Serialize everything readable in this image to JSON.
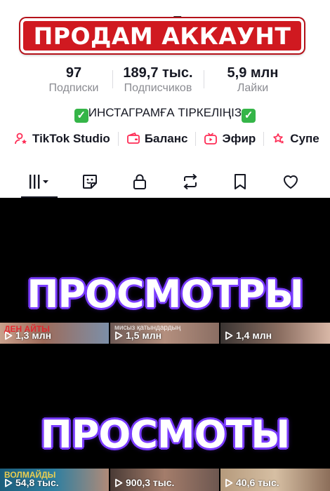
{
  "banner": {
    "sale_text": "ПРОДАМ  АККАУНТ"
  },
  "profile_name_fragment": "E",
  "stats": [
    {
      "value": "97",
      "label": "Подписки"
    },
    {
      "value": "189,7 тыс.",
      "label": "Подписчиков"
    },
    {
      "value": "5,9 млн",
      "label": "Лайки"
    }
  ],
  "bio": {
    "text": "ИНСТАГРАМҒА ТІРКЕЛІҢІЗ"
  },
  "actions": [
    {
      "label": "TikTok Studio",
      "icon": "person-star-icon"
    },
    {
      "label": "Баланс",
      "icon": "wallet-icon"
    },
    {
      "label": "Эфир",
      "icon": "live-tv-icon"
    },
    {
      "label": "Супе",
      "icon": "super-stars-icon"
    }
  ],
  "tabs": [
    {
      "name": "videos-grid",
      "icon": "grid-bars-icon",
      "active": true
    },
    {
      "name": "stickers",
      "icon": "sticker-icon"
    },
    {
      "name": "private",
      "icon": "lock-icon"
    },
    {
      "name": "reposts",
      "icon": "repost-icon"
    },
    {
      "name": "favorites",
      "icon": "bookmark-icon"
    },
    {
      "name": "liked",
      "icon": "heart-icon"
    }
  ],
  "overlay": {
    "views_heading_1": "ПРОСМОТРЫ",
    "views_heading_2": "ПРОСМОТЫ"
  },
  "thumbs_row_1": [
    {
      "views": "1,3 млн",
      "caption": "ДЕН АЙТЫ"
    },
    {
      "views": "1,5 млн",
      "caption": "мисыз қатындардың"
    },
    {
      "views": "1,4 млн",
      "caption": ""
    }
  ],
  "thumbs_row_2": [
    {
      "views": "54,8 тыс.",
      "caption": "ВОЛМАЙДЫ"
    },
    {
      "views": "900,3 тыс.",
      "caption": ""
    },
    {
      "views": "40,6 тыс.",
      "caption": ""
    }
  ],
  "colors": {
    "banner_red": "#d01920",
    "overlay_purple": "#7a3cff",
    "action_pink": "#fe2c55",
    "check_green": "#35b548"
  }
}
